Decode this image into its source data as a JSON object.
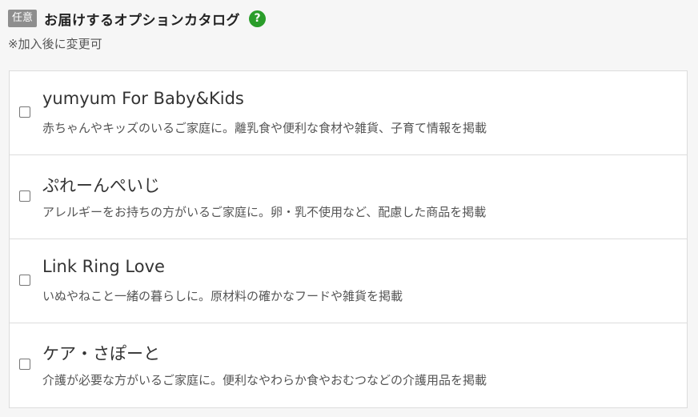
{
  "header": {
    "badge": "任意",
    "title": "お届けするオプションカタログ",
    "help_icon": "question-circle-icon",
    "help_symbol": "?"
  },
  "note": "※加入後に変更可",
  "options": [
    {
      "name": "yumyum For Baby&Kids",
      "description": "赤ちゃんやキッズのいるご家庭に。離乳食や便利な食材や雑貨、子育て情報を掲載",
      "checked": false
    },
    {
      "name": "ぷれーんぺいじ",
      "description": "アレルギーをお持ちの方がいるご家庭に。卵・乳不使用など、配慮した商品を掲載",
      "checked": false
    },
    {
      "name": "Link Ring Love",
      "description": "いぬやねこと一緒の暮らしに。原材料の確かなフードや雑貨を掲載",
      "checked": false
    },
    {
      "name": "ケア・さぽーと",
      "description": "介護が必要な方がいるご家庭に。便利なやわらか食やおむつなどの介護用品を掲載",
      "checked": false
    }
  ],
  "colors": {
    "badge_bg": "#8e8e8e",
    "help_icon_bg": "#2a9d2a",
    "border": "#dcdcdc",
    "page_bg": "#f6f6f6"
  }
}
